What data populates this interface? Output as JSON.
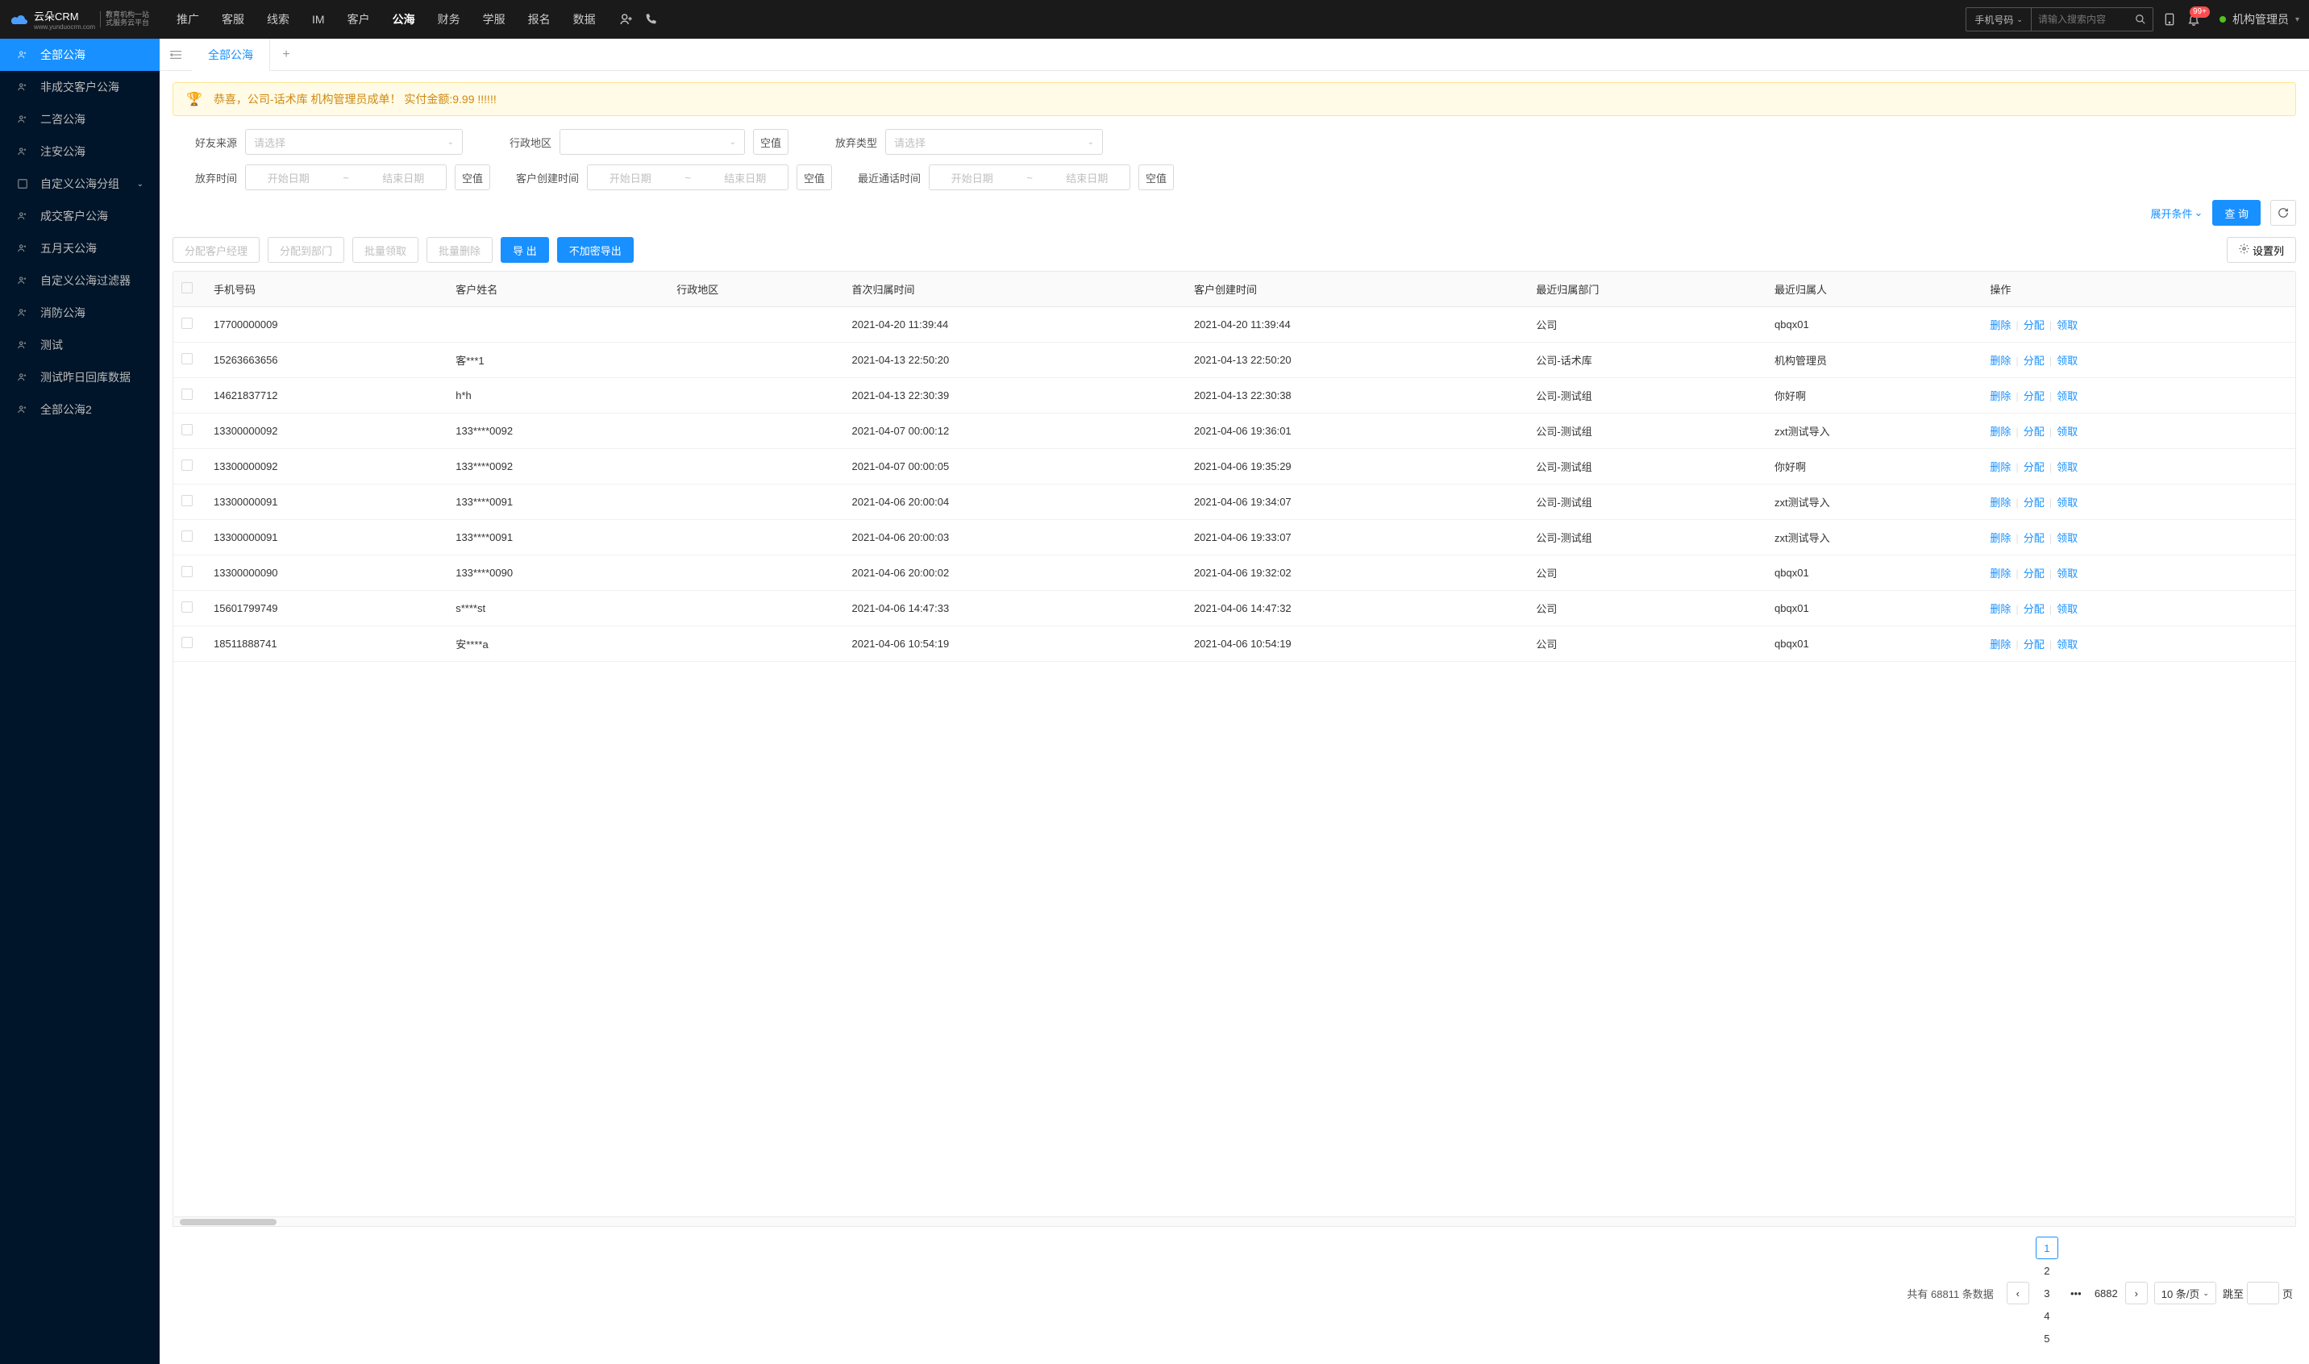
{
  "header": {
    "logo_text": "云朵CRM",
    "logo_sub1": "教育机构一站",
    "logo_sub2": "式服务云平台",
    "logo_url": "www.yunduocrm.com",
    "nav": [
      "推广",
      "客服",
      "线索",
      "IM",
      "客户",
      "公海",
      "财务",
      "学服",
      "报名",
      "数据"
    ],
    "nav_active": 5,
    "search_type": "手机号码",
    "search_placeholder": "请输入搜索内容",
    "notif_badge": "99+",
    "user": "机构管理员"
  },
  "sidebar": [
    {
      "label": "全部公海",
      "icon": "users"
    },
    {
      "label": "非成交客户公海",
      "icon": "users"
    },
    {
      "label": "二咨公海",
      "icon": "users"
    },
    {
      "label": "注安公海",
      "icon": "users"
    },
    {
      "label": "自定义公海分组",
      "icon": "layers",
      "chev": true
    },
    {
      "label": "成交客户公海",
      "icon": "users"
    },
    {
      "label": "五月天公海",
      "icon": "users"
    },
    {
      "label": "自定义公海过滤器",
      "icon": "users"
    },
    {
      "label": "消防公海",
      "icon": "users"
    },
    {
      "label": "测试",
      "icon": "users"
    },
    {
      "label": "测试昨日回库数据",
      "icon": "users"
    },
    {
      "label": "全部公海2",
      "icon": "users"
    }
  ],
  "sidebar_active": 0,
  "tabs": {
    "main_tab": "全部公海"
  },
  "alert": "恭喜，公司-话术库  机构管理员成单！  实付金额:9.99 !!!!!!",
  "filters": {
    "friend_source": {
      "label": "好友来源",
      "placeholder": "请选择"
    },
    "admin_region": {
      "label": "行政地区",
      "empty": "空值"
    },
    "abandon_type": {
      "label": "放弃类型",
      "placeholder": "请选择"
    },
    "abandon_time": {
      "label": "放弃时间",
      "start": "开始日期",
      "end": "结束日期",
      "empty": "空值"
    },
    "create_time": {
      "label": "客户创建时间",
      "start": "开始日期",
      "end": "结束日期",
      "empty": "空值"
    },
    "call_time": {
      "label": "最近通话时间",
      "start": "开始日期",
      "end": "结束日期",
      "empty": "空值"
    },
    "expand": "展开条件",
    "search_btn": "查 询"
  },
  "toolbar": {
    "assign_manager": "分配客户经理",
    "assign_dept": "分配到部门",
    "batch_claim": "批量领取",
    "batch_delete": "批量删除",
    "export": "导 出",
    "export_plain": "不加密导出",
    "set_cols": "设置列"
  },
  "columns": [
    "手机号码",
    "客户姓名",
    "行政地区",
    "首次归属时间",
    "客户创建时间",
    "最近归属部门",
    "最近归属人",
    "操作"
  ],
  "rows": [
    {
      "phone": "17700000009",
      "name": "",
      "region": "",
      "first": "2021-04-20 11:39:44",
      "created": "2021-04-20 11:39:44",
      "dept": "公司",
      "owner": "qbqx01"
    },
    {
      "phone": "15263663656",
      "name": "客***1",
      "region": "",
      "first": "2021-04-13 22:50:20",
      "created": "2021-04-13 22:50:20",
      "dept": "公司-话术库",
      "owner": "机构管理员"
    },
    {
      "phone": "14621837712",
      "name": "h*h",
      "region": "",
      "first": "2021-04-13 22:30:39",
      "created": "2021-04-13 22:30:38",
      "dept": "公司-测试组",
      "owner": "你好啊"
    },
    {
      "phone": "13300000092",
      "name": "133****0092",
      "region": "",
      "first": "2021-04-07 00:00:12",
      "created": "2021-04-06 19:36:01",
      "dept": "公司-测试组",
      "owner": "zxt测试导入"
    },
    {
      "phone": "13300000092",
      "name": "133****0092",
      "region": "",
      "first": "2021-04-07 00:00:05",
      "created": "2021-04-06 19:35:29",
      "dept": "公司-测试组",
      "owner": "你好啊"
    },
    {
      "phone": "13300000091",
      "name": "133****0091",
      "region": "",
      "first": "2021-04-06 20:00:04",
      "created": "2021-04-06 19:34:07",
      "dept": "公司-测试组",
      "owner": "zxt测试导入"
    },
    {
      "phone": "13300000091",
      "name": "133****0091",
      "region": "",
      "first": "2021-04-06 20:00:03",
      "created": "2021-04-06 19:33:07",
      "dept": "公司-测试组",
      "owner": "zxt测试导入"
    },
    {
      "phone": "13300000090",
      "name": "133****0090",
      "region": "",
      "first": "2021-04-06 20:00:02",
      "created": "2021-04-06 19:32:02",
      "dept": "公司",
      "owner": "qbqx01"
    },
    {
      "phone": "15601799749",
      "name": "s****st",
      "region": "",
      "first": "2021-04-06 14:47:33",
      "created": "2021-04-06 14:47:32",
      "dept": "公司",
      "owner": "qbqx01"
    },
    {
      "phone": "18511888741",
      "name": "安****a",
      "region": "",
      "first": "2021-04-06 10:54:19",
      "created": "2021-04-06 10:54:19",
      "dept": "公司",
      "owner": "qbqx01"
    }
  ],
  "ops": {
    "delete": "删除",
    "assign": "分配",
    "claim": "领取"
  },
  "pagination": {
    "total_prefix": "共有",
    "total": "68811",
    "total_suffix": "条数据",
    "pages": [
      "1",
      "2",
      "3",
      "4",
      "5"
    ],
    "last": "6882",
    "size": "10 条/页",
    "jump1": "跳至",
    "jump2": "页"
  }
}
